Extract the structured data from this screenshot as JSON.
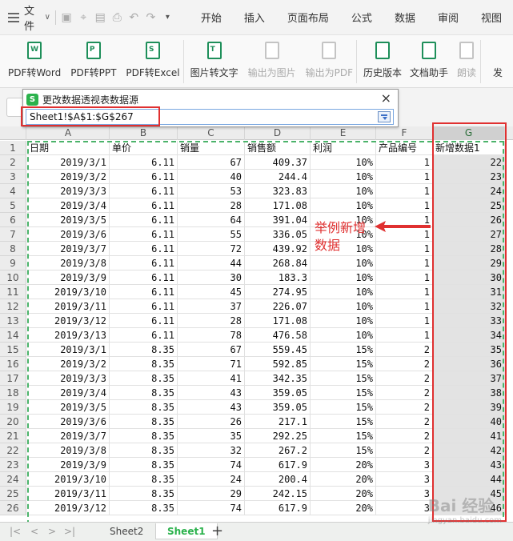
{
  "menubar": {
    "file": "文件",
    "tabs": [
      "开始",
      "插入",
      "页面布局",
      "公式",
      "数据",
      "审阅",
      "视图"
    ]
  },
  "ribbon": {
    "buttons": [
      {
        "label": "PDF转Word",
        "icon": "pdf-to-word-icon",
        "enabled": true
      },
      {
        "label": "PDF转PPT",
        "icon": "pdf-to-ppt-icon",
        "enabled": true
      },
      {
        "label": "PDF转Excel",
        "icon": "pdf-to-excel-icon",
        "enabled": true
      },
      {
        "label": "图片转文字",
        "icon": "image-to-text-icon",
        "enabled": true
      },
      {
        "label": "输出为图片",
        "icon": "export-image-icon",
        "enabled": false
      },
      {
        "label": "输出为PDF",
        "icon": "export-pdf-icon",
        "enabled": false
      },
      {
        "label": "历史版本",
        "icon": "history-version-icon",
        "enabled": true
      },
      {
        "label": "文档助手",
        "icon": "doc-assistant-icon",
        "enabled": true
      },
      {
        "label": "朗读",
        "icon": "read-aloud-icon",
        "enabled": false
      },
      {
        "label": "发",
        "icon": "send-icon",
        "enabled": true
      }
    ]
  },
  "dialog": {
    "title": "更改数据透视表数据源",
    "range_value": "Sheet1!$A$1:$G$267",
    "close": "×"
  },
  "sheet": {
    "columns": [
      "A",
      "B",
      "C",
      "D",
      "E",
      "F",
      "G"
    ],
    "headers": [
      "日期",
      "单价",
      "销量",
      "销售额",
      "利润",
      "产品编号",
      "新增数据1"
    ],
    "rows": [
      [
        "2019/3/1",
        "6.11",
        "67",
        "409.37",
        "10%",
        "1",
        "22"
      ],
      [
        "2019/3/2",
        "6.11",
        "40",
        "244.4",
        "10%",
        "1",
        "23"
      ],
      [
        "2019/3/3",
        "6.11",
        "53",
        "323.83",
        "10%",
        "1",
        "24"
      ],
      [
        "2019/3/4",
        "6.11",
        "28",
        "171.08",
        "10%",
        "1",
        "25"
      ],
      [
        "2019/3/5",
        "6.11",
        "64",
        "391.04",
        "10%",
        "1",
        "26"
      ],
      [
        "2019/3/6",
        "6.11",
        "55",
        "336.05",
        "10%",
        "1",
        "27"
      ],
      [
        "2019/3/7",
        "6.11",
        "72",
        "439.92",
        "10%",
        "1",
        "28"
      ],
      [
        "2019/3/8",
        "6.11",
        "44",
        "268.84",
        "10%",
        "1",
        "29"
      ],
      [
        "2019/3/9",
        "6.11",
        "30",
        "183.3",
        "10%",
        "1",
        "30"
      ],
      [
        "2019/3/10",
        "6.11",
        "45",
        "274.95",
        "10%",
        "1",
        "31"
      ],
      [
        "2019/3/11",
        "6.11",
        "37",
        "226.07",
        "10%",
        "1",
        "32"
      ],
      [
        "2019/3/12",
        "6.11",
        "28",
        "171.08",
        "10%",
        "1",
        "33"
      ],
      [
        "2019/3/13",
        "6.11",
        "78",
        "476.58",
        "10%",
        "1",
        "34"
      ],
      [
        "2019/3/1",
        "8.35",
        "67",
        "559.45",
        "15%",
        "2",
        "35"
      ],
      [
        "2019/3/2",
        "8.35",
        "71",
        "592.85",
        "15%",
        "2",
        "36"
      ],
      [
        "2019/3/3",
        "8.35",
        "41",
        "342.35",
        "15%",
        "2",
        "37"
      ],
      [
        "2019/3/4",
        "8.35",
        "43",
        "359.05",
        "15%",
        "2",
        "38"
      ],
      [
        "2019/3/5",
        "8.35",
        "43",
        "359.05",
        "15%",
        "2",
        "39"
      ],
      [
        "2019/3/6",
        "8.35",
        "26",
        "217.1",
        "15%",
        "2",
        "40"
      ],
      [
        "2019/3/7",
        "8.35",
        "35",
        "292.25",
        "15%",
        "2",
        "41"
      ],
      [
        "2019/3/8",
        "8.35",
        "32",
        "267.2",
        "15%",
        "2",
        "42"
      ],
      [
        "2019/3/9",
        "8.35",
        "74",
        "617.9",
        "20%",
        "3",
        "43"
      ],
      [
        "2019/3/10",
        "8.35",
        "24",
        "200.4",
        "20%",
        "3",
        "44"
      ],
      [
        "2019/3/11",
        "8.35",
        "29",
        "242.15",
        "20%",
        "3",
        "45"
      ],
      [
        "2019/3/12",
        "8.35",
        "74",
        "617.9",
        "20%",
        "3",
        "46"
      ]
    ],
    "row_numbers": [
      "1",
      "2",
      "3",
      "4",
      "5",
      "6",
      "7",
      "8",
      "9",
      "10",
      "11",
      "12",
      "13",
      "14",
      "15",
      "16",
      "17",
      "18",
      "19",
      "20",
      "21",
      "22",
      "23",
      "24",
      "25",
      "26"
    ],
    "selected_column": "G"
  },
  "annotation": {
    "line1": "举例新增",
    "line2": "数据",
    "color": "#e03030"
  },
  "sheet_tabs": [
    {
      "label": "Sheet2",
      "active": false
    },
    {
      "label": "Sheet1",
      "active": true
    }
  ],
  "add_sheet": "+",
  "watermark": {
    "brand": "Bai 经验",
    "url": "jingyan.baidu.com"
  },
  "colors": {
    "accent_green": "#2bb24c",
    "marching_ants": "#4bb36a",
    "highlight_red": "#e03030"
  }
}
